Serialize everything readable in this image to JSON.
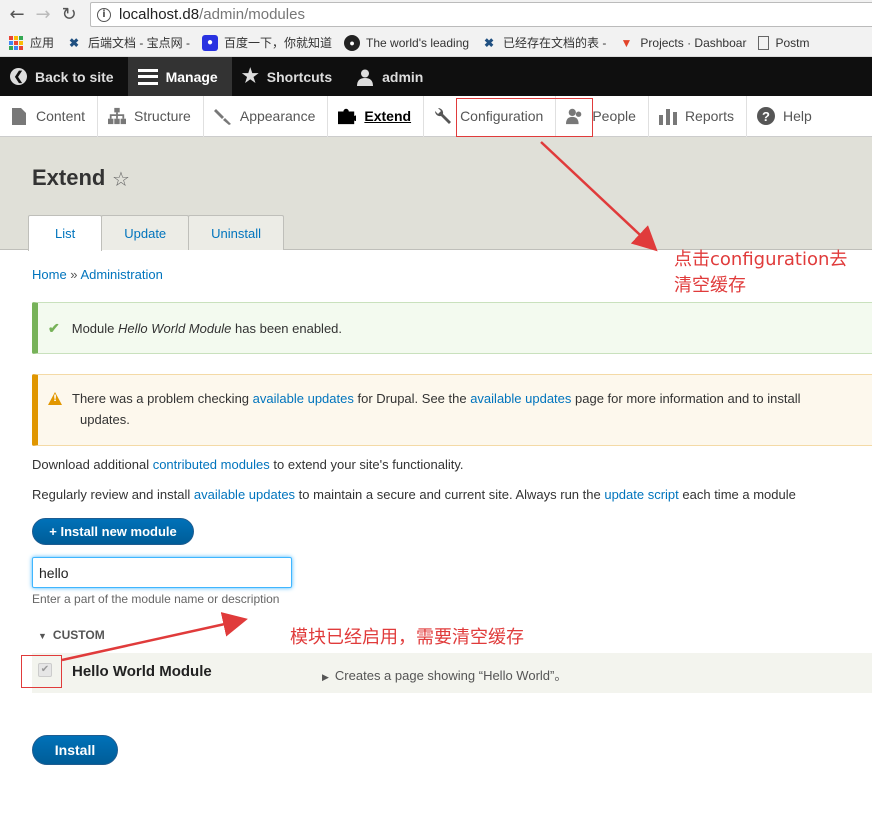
{
  "browser": {
    "url_host": "localhost.d8",
    "url_path": "/admin/modules",
    "bookmarks": [
      {
        "label": "应用",
        "icon": "apps-grid-icon"
      },
      {
        "label": "后端文档 - 宝点网 - ",
        "icon": "confluence-icon"
      },
      {
        "label": "百度一下，你就知道",
        "icon": "baidu-paw-icon"
      },
      {
        "label": "The world's leading",
        "icon": "github-icon"
      },
      {
        "label": "已经存在文档的表 - ",
        "icon": "confluence-icon"
      },
      {
        "label": "Projects · Dashboar",
        "icon": "gitlab-icon"
      },
      {
        "label": "Postm",
        "icon": "page-icon"
      }
    ]
  },
  "toolbar": {
    "back": "Back to site",
    "manage": "Manage",
    "shortcuts": "Shortcuts",
    "user": "admin"
  },
  "tray": {
    "items": [
      {
        "label": "Content",
        "icon": "content-page-icon"
      },
      {
        "label": "Structure",
        "icon": "structure-icon"
      },
      {
        "label": "Appearance",
        "icon": "brush-icon"
      },
      {
        "label": "Extend",
        "icon": "puzzle-icon"
      },
      {
        "label": "Configuration",
        "icon": "wrench-icon"
      },
      {
        "label": "People",
        "icon": "people-icon"
      },
      {
        "label": "Reports",
        "icon": "bar-chart-icon"
      },
      {
        "label": "Help",
        "icon": "help-icon"
      }
    ]
  },
  "page": {
    "title": "Extend",
    "tabs": [
      "List",
      "Update",
      "Uninstall"
    ],
    "breadcrumb": {
      "home": "Home",
      "sep": " » ",
      "admin": "Administration"
    },
    "status": {
      "prefix": "Module ",
      "module": "Hello World Module",
      "suffix": " has been enabled."
    },
    "warning": {
      "t1": "There was a problem checking ",
      "l1": "available updates",
      "t2": " for Drupal. See the ",
      "l2": "available updates",
      "t3": " page for more information and to install",
      "t4": "updates."
    },
    "para1": {
      "t1": "Download additional ",
      "l1": "contributed modules",
      "t2": " to extend your site's functionality."
    },
    "para2": {
      "t1": "Regularly review and install ",
      "l1": "available updates",
      "t2": " to maintain a secure and current site. Always run the ",
      "l2": "update script",
      "t3": " each time a module"
    },
    "install_new": "+ Install new module",
    "filter_value": "hello",
    "filter_help": "Enter a part of the module name or description",
    "group": "CUSTOM",
    "module_name": "Hello World Module",
    "module_desc": "Creates a page showing “Hello World”。",
    "install": "Install"
  },
  "annotations": {
    "config_note_line1": "点击configuration去",
    "config_note_line2": "清空缓存",
    "module_note": "模块已经启用，需要清空缓存",
    "color": "#e03b3b"
  }
}
